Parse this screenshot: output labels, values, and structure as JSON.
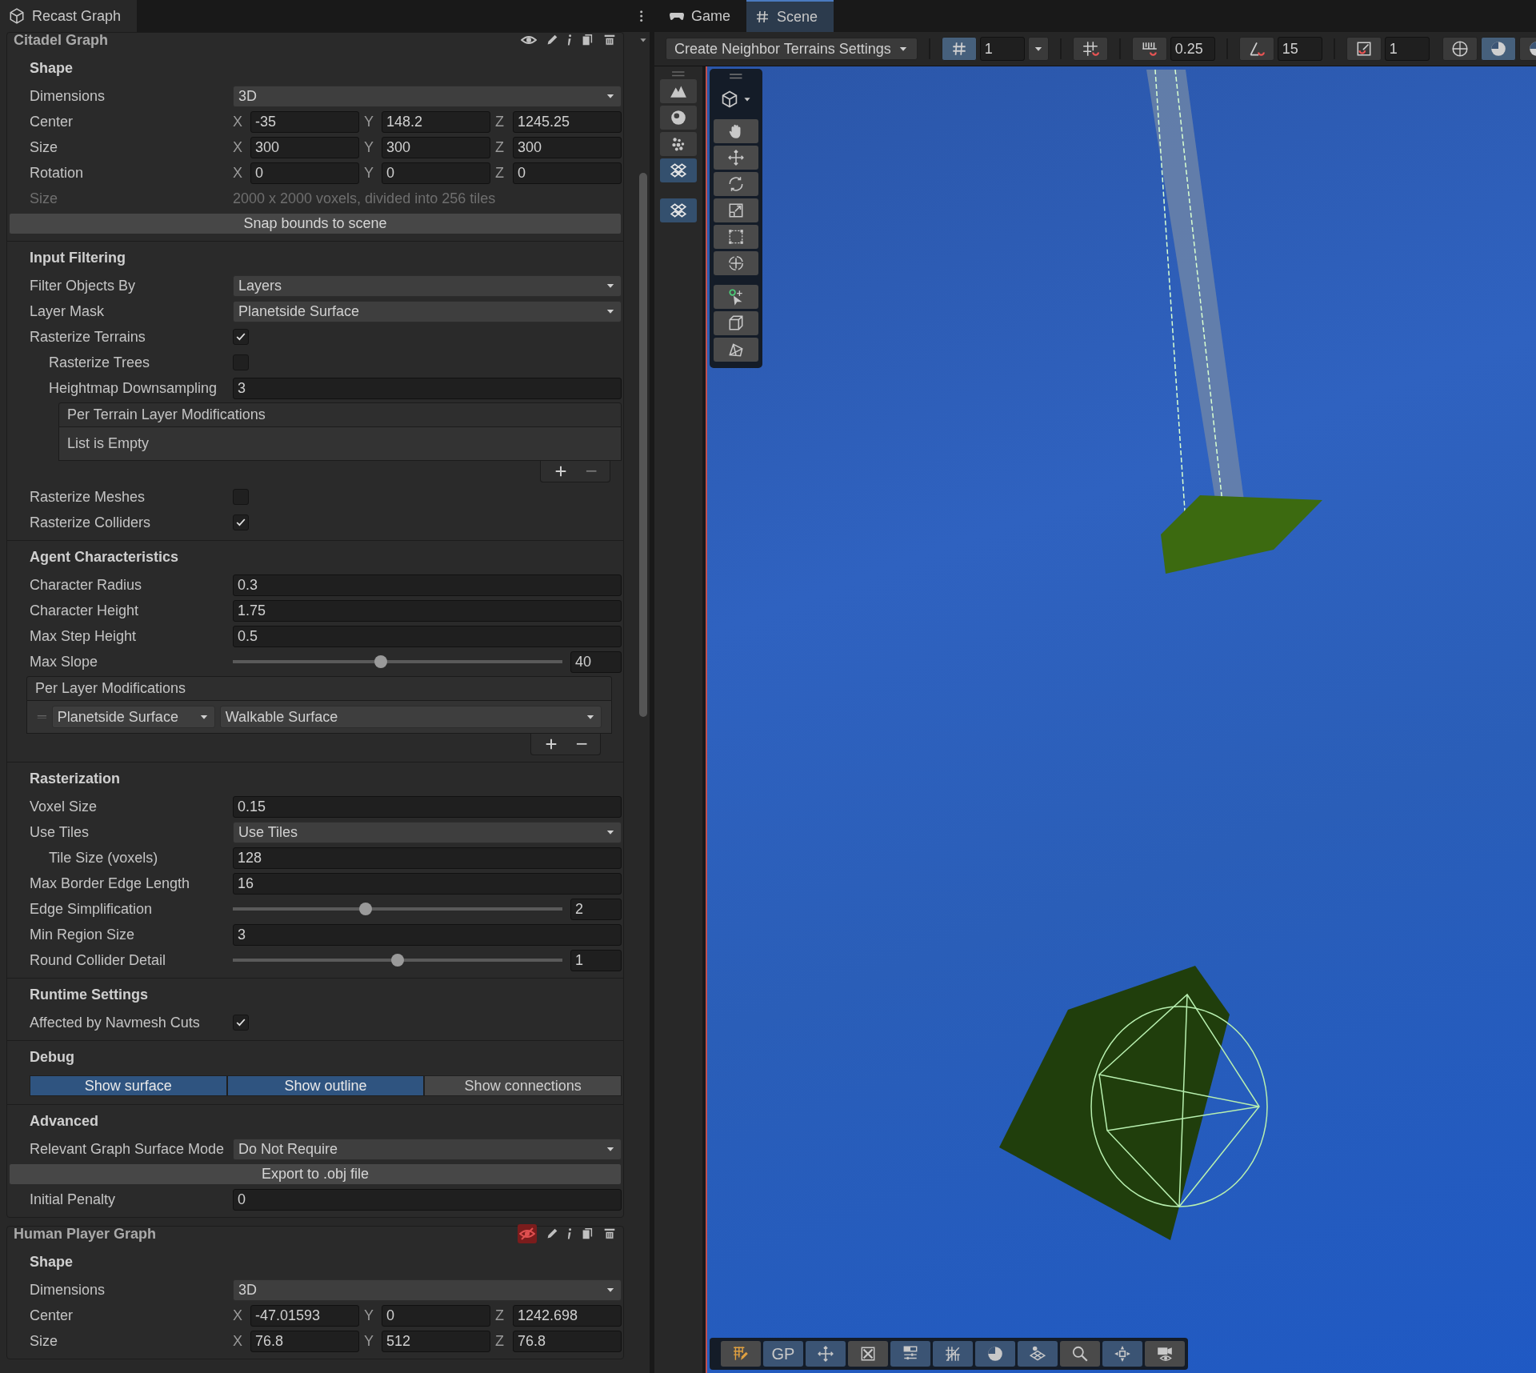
{
  "inspector_tab": {
    "label": "Recast Graph",
    "selected": true
  },
  "scene_tabs": [
    {
      "label": "Game",
      "selected": false
    },
    {
      "label": "Scene",
      "selected": true
    }
  ],
  "graphs": [
    {
      "title": "Citadel Graph",
      "visible": true,
      "sections": [
        {
          "title": "Shape",
          "rows": [
            {
              "kind": "dropdown",
              "label": "Dimensions",
              "value": "3D"
            },
            {
              "kind": "vector3",
              "label": "Center",
              "axes": [
                {
                  "axis": "X",
                  "value": "-35"
                },
                {
                  "axis": "Y",
                  "value": "148.2"
                },
                {
                  "axis": "Z",
                  "value": "1245.25"
                }
              ]
            },
            {
              "kind": "vector3",
              "label": "Size",
              "axes": [
                {
                  "axis": "X",
                  "value": "300"
                },
                {
                  "axis": "Y",
                  "value": "300"
                },
                {
                  "axis": "Z",
                  "value": "300"
                }
              ]
            },
            {
              "kind": "vector3",
              "label": "Rotation",
              "axes": [
                {
                  "axis": "X",
                  "value": "0"
                },
                {
                  "axis": "Y",
                  "value": "0"
                },
                {
                  "axis": "Z",
                  "value": "0"
                }
              ]
            },
            {
              "kind": "info",
              "label": "Size",
              "value": "2000 x 2000 voxels, divided into 256 tiles"
            },
            {
              "kind": "button",
              "label": "Snap bounds to scene"
            }
          ]
        },
        {
          "title": "Input Filtering",
          "rows": [
            {
              "kind": "dropdown",
              "label": "Filter Objects By",
              "value": "Layers"
            },
            {
              "kind": "dropdown",
              "label": "Layer Mask",
              "value": "Planetside Surface"
            },
            {
              "kind": "checkbox",
              "label": "Rasterize Terrains",
              "checked": true,
              "children": [
                {
                  "kind": "checkbox",
                  "label": "Rasterize Trees",
                  "checked": false
                },
                {
                  "kind": "number",
                  "label": "Heightmap Downsampling",
                  "value": "3"
                },
                {
                  "kind": "list",
                  "label": "Per Terrain Layer Modifications",
                  "empty_text": "List is Empty"
                }
              ]
            },
            {
              "kind": "checkbox",
              "label": "Rasterize Meshes",
              "checked": false
            },
            {
              "kind": "checkbox",
              "label": "Rasterize Colliders",
              "checked": true
            }
          ]
        },
        {
          "title": "Agent Characteristics",
          "rows": [
            {
              "kind": "number",
              "label": "Character Radius",
              "value": "0.3"
            },
            {
              "kind": "number",
              "label": "Character Height",
              "value": "1.75"
            },
            {
              "kind": "number",
              "label": "Max Step Height",
              "value": "0.5"
            },
            {
              "kind": "slider",
              "label": "Max Slope",
              "level": 0.446,
              "value": "40"
            },
            {
              "kind": "layer_mods",
              "label": "Per Layer Modifications",
              "entries": [
                {
                  "layer": "Planetside Surface",
                  "mode": "Walkable Surface"
                }
              ]
            }
          ]
        },
        {
          "title": "Rasterization",
          "rows": [
            {
              "kind": "number",
              "label": "Voxel Size",
              "value": "0.15"
            },
            {
              "kind": "dropdown",
              "label": "Use Tiles",
              "value": "Use Tiles",
              "children": [
                {
                  "kind": "number",
                  "label": "Tile Size (voxels)",
                  "value": "128"
                }
              ]
            },
            {
              "kind": "number",
              "label": "Max Border Edge Length",
              "value": "16"
            },
            {
              "kind": "slider",
              "label": "Edge Simplification",
              "level": 0.4,
              "value": "2"
            },
            {
              "kind": "number",
              "label": "Min Region Size",
              "value": "3"
            },
            {
              "kind": "slider",
              "label": "Round Collider Detail",
              "level": 0.5,
              "value": "1"
            }
          ]
        },
        {
          "title": "Runtime Settings",
          "rows": [
            {
              "kind": "checkbox",
              "label": "Affected by Navmesh Cuts",
              "checked": true
            }
          ]
        },
        {
          "title": "Debug",
          "rows": [
            {
              "kind": "toggles",
              "options": [
                {
                  "label": "Show surface",
                  "selected": true
                },
                {
                  "label": "Show outline",
                  "selected": true
                },
                {
                  "label": "Show connections",
                  "selected": false
                }
              ]
            }
          ]
        },
        {
          "title": "Advanced",
          "rows": [
            {
              "kind": "dropdown",
              "label": "Relevant Graph Surface Mode",
              "value": "Do Not Require"
            },
            {
              "kind": "button",
              "label": "Export to .obj file"
            },
            {
              "kind": "number",
              "label": "Initial Penalty",
              "value": "0"
            }
          ]
        }
      ]
    },
    {
      "title": "Human Player Graph",
      "visible": false,
      "sections": [
        {
          "title": "Shape",
          "rows": [
            {
              "kind": "dropdown",
              "label": "Dimensions",
              "value": "3D"
            },
            {
              "kind": "vector3",
              "label": "Center",
              "axes": [
                {
                  "axis": "X",
                  "value": "-47.01593"
                },
                {
                  "axis": "Y",
                  "value": "0"
                },
                {
                  "axis": "Z",
                  "value": "1242.698"
                }
              ]
            },
            {
              "kind": "vector3",
              "label": "Size",
              "axes": [
                {
                  "axis": "X",
                  "value": "76.8"
                },
                {
                  "axis": "Y",
                  "value": "512"
                },
                {
                  "axis": "Z",
                  "value": "76.8"
                }
              ]
            }
          ]
        }
      ]
    }
  ],
  "scene_toolbar": {
    "overlay_menu": "Create Neighbor Terrains Settings",
    "grid": {
      "on": true,
      "value": "1"
    },
    "snaps": [
      {
        "kind": "snap"
      },
      {
        "kind": "increment",
        "value": "0.25"
      },
      {
        "kind": "rotate",
        "value": "15"
      },
      {
        "kind": "scale",
        "value": "1"
      }
    ],
    "shading": [
      {
        "selected": false
      },
      {
        "selected": true
      },
      {
        "selected": false
      }
    ]
  },
  "tool_strip": [
    {
      "selected": false
    },
    {
      "selected": false
    },
    {
      "selected": false
    },
    {
      "selected": true
    },
    {
      "selected": true
    }
  ],
  "scene_tools": [
    {
      "selected": false
    },
    {
      "selected": false
    },
    {
      "selected": false
    },
    {
      "selected": false
    },
    {
      "selected": false
    },
    {
      "selected": false
    },
    {
      "selected": false
    },
    {
      "selected": false
    },
    {
      "selected": false
    }
  ],
  "bottom_toolbar": [
    {
      "selected": false
    },
    {
      "selected": true,
      "label": "GP"
    },
    {
      "selected": true
    },
    {
      "selected": false
    },
    {
      "selected": true
    },
    {
      "selected": true
    },
    {
      "selected": true
    },
    {
      "selected": true
    },
    {
      "selected": false
    },
    {
      "selected": true
    },
    {
      "selected": false
    }
  ]
}
